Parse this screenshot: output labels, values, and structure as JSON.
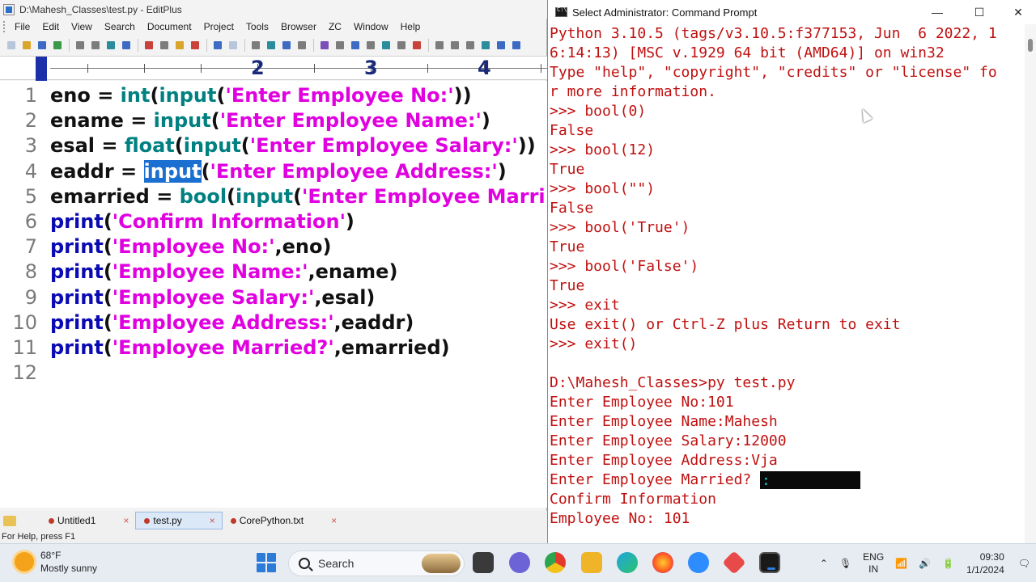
{
  "editplus": {
    "title": "D:\\Mahesh_Classes\\test.py - EditPlus",
    "menu": [
      "File",
      "Edit",
      "View",
      "Search",
      "Document",
      "Project",
      "Tools",
      "Browser",
      "ZC",
      "Window",
      "Help"
    ],
    "ruler_numbers": [
      "2",
      "3",
      "4"
    ],
    "code_lines": [
      {
        "n": "1",
        "parts": [
          [
            "eno = ",
            "plain"
          ],
          [
            "int",
            "fn"
          ],
          [
            "(",
            "plain"
          ],
          [
            "input",
            "fn"
          ],
          [
            "(",
            "plain"
          ],
          [
            "'Enter Employee No:'",
            "str"
          ],
          [
            "))",
            "plain"
          ]
        ]
      },
      {
        "n": "2",
        "parts": [
          [
            "ename = ",
            "plain"
          ],
          [
            "input",
            "fn"
          ],
          [
            "(",
            "plain"
          ],
          [
            "'Enter Employee Name:'",
            "str"
          ],
          [
            ")",
            "plain"
          ]
        ]
      },
      {
        "n": "3",
        "parts": [
          [
            "esal = ",
            "plain"
          ],
          [
            "float",
            "fn"
          ],
          [
            "(",
            "plain"
          ],
          [
            "input",
            "fn"
          ],
          [
            "(",
            "plain"
          ],
          [
            "'Enter Employee Salary:'",
            "str"
          ],
          [
            "))",
            "plain"
          ]
        ]
      },
      {
        "n": "4",
        "parts": [
          [
            "eaddr = ",
            "plain"
          ],
          [
            "input",
            "sel"
          ],
          [
            "(",
            "plain"
          ],
          [
            "'Enter Employee Address:'",
            "str"
          ],
          [
            ")",
            "plain"
          ]
        ]
      },
      {
        "n": "5",
        "parts": [
          [
            "emarried = ",
            "plain"
          ],
          [
            "bool",
            "fn"
          ],
          [
            "(",
            "plain"
          ],
          [
            "input",
            "fn"
          ],
          [
            "(",
            "plain"
          ],
          [
            "'Enter Employee Marri",
            "str"
          ]
        ]
      },
      {
        "n": "6",
        "parts": [
          [
            "print",
            "kw"
          ],
          [
            "(",
            "plain"
          ],
          [
            "'Confirm Information'",
            "str"
          ],
          [
            ")",
            "plain"
          ]
        ]
      },
      {
        "n": "7",
        "parts": [
          [
            "print",
            "kw"
          ],
          [
            "(",
            "plain"
          ],
          [
            "'Employee No:'",
            "str"
          ],
          [
            ",eno)",
            "plain"
          ]
        ]
      },
      {
        "n": "8",
        "parts": [
          [
            "print",
            "kw"
          ],
          [
            "(",
            "plain"
          ],
          [
            "'Employee Name:'",
            "str"
          ],
          [
            ",ename)",
            "plain"
          ]
        ]
      },
      {
        "n": "9",
        "parts": [
          [
            "print",
            "kw"
          ],
          [
            "(",
            "plain"
          ],
          [
            "'Employee Salary:'",
            "str"
          ],
          [
            ",esal)",
            "plain"
          ]
        ]
      },
      {
        "n": "10",
        "parts": [
          [
            "print",
            "kw"
          ],
          [
            "(",
            "plain"
          ],
          [
            "'Employee Address:'",
            "str"
          ],
          [
            ",eaddr)",
            "plain"
          ]
        ]
      },
      {
        "n": "11",
        "parts": [
          [
            "print",
            "kw"
          ],
          [
            "(",
            "plain"
          ],
          [
            "'Employee Married?'",
            "str"
          ],
          [
            ",emarried)",
            "plain"
          ]
        ]
      },
      {
        "n": "12",
        "parts": []
      }
    ],
    "tabs": [
      {
        "label": "Untitled1",
        "close": "×",
        "active": false
      },
      {
        "label": "test.py",
        "close": "×",
        "active": true
      },
      {
        "label": "CorePython.txt",
        "close": "×",
        "active": false
      }
    ],
    "status": "For Help, press F1"
  },
  "cmd": {
    "title": "Select Administrator: Command Prompt",
    "controls": {
      "minimize": "—",
      "maximize": "☐",
      "close": "✕"
    },
    "lines": [
      "Python 3.10.5 (tags/v3.10.5:f377153, Jun  6 2022, 1",
      "6:14:13) [MSC v.1929 64 bit (AMD64)] on win32",
      "Type \"help\", \"copyright\", \"credits\" or \"license\" fo",
      "r more information.",
      ">>> bool(0)",
      "False",
      ">>> bool(12)",
      "True",
      ">>> bool(\"\")",
      "False",
      ">>> bool('True')",
      "True",
      ">>> bool('False')",
      "True",
      ">>> exit",
      "Use exit() or Ctrl-Z plus Return to exit",
      ">>> exit()",
      "",
      "D:\\Mahesh_Classes>py test.py",
      "Enter Employee No:101",
      "Enter Employee Name:Mahesh",
      "Enter Employee Salary:12000",
      "Enter Employee Address:Vja",
      "Enter Employee Married?",
      "Confirm Information",
      "Employee No: 101"
    ],
    "input_cursor_text": ":"
  },
  "taskbar": {
    "weather_temp": "68°F",
    "weather_desc": "Mostly sunny",
    "search_label": "Search",
    "lang_top": "ENG",
    "lang_bottom": "IN",
    "time": "09:30",
    "date": "1/1/2024"
  }
}
